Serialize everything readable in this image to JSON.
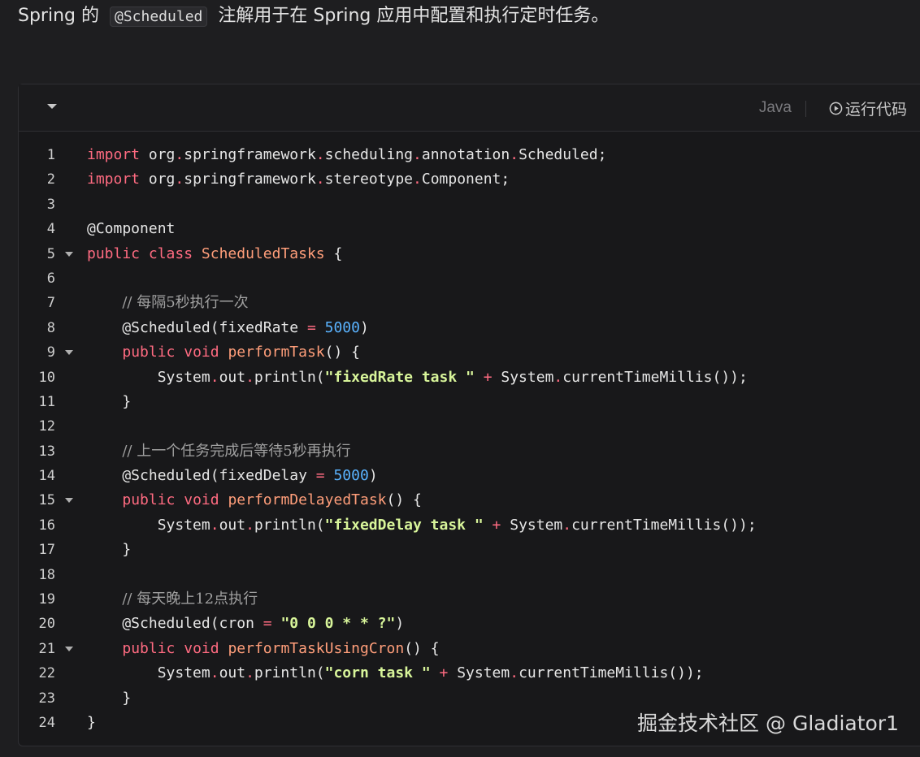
{
  "intro": {
    "before": "Spring 的",
    "code": "@Scheduled",
    "after": "注解用于在 Spring 应用中配置和执行定时任务。"
  },
  "code_block": {
    "language": "Java",
    "run_label": "运行代码",
    "lines": [
      {
        "n": "1",
        "fold": false,
        "tokens": [
          [
            "keyword",
            "import"
          ],
          [
            "plain",
            " org"
          ],
          [
            "punct",
            "."
          ],
          [
            "plain",
            "springframework"
          ],
          [
            "punct",
            "."
          ],
          [
            "plain",
            "scheduling"
          ],
          [
            "punct",
            "."
          ],
          [
            "plain",
            "annotation"
          ],
          [
            "punct",
            "."
          ],
          [
            "plain",
            "Scheduled;"
          ]
        ]
      },
      {
        "n": "2",
        "fold": false,
        "tokens": [
          [
            "keyword",
            "import"
          ],
          [
            "plain",
            " org"
          ],
          [
            "punct",
            "."
          ],
          [
            "plain",
            "springframework"
          ],
          [
            "punct",
            "."
          ],
          [
            "plain",
            "stereotype"
          ],
          [
            "punct",
            "."
          ],
          [
            "plain",
            "Component;"
          ]
        ]
      },
      {
        "n": "3",
        "fold": false,
        "tokens": []
      },
      {
        "n": "4",
        "fold": false,
        "tokens": [
          [
            "plain",
            "@Component"
          ]
        ]
      },
      {
        "n": "5",
        "fold": true,
        "tokens": [
          [
            "keyword",
            "public"
          ],
          [
            "plain",
            " "
          ],
          [
            "keyword",
            "class"
          ],
          [
            "plain",
            " "
          ],
          [
            "class",
            "ScheduledTasks"
          ],
          [
            "plain",
            " {"
          ]
        ]
      },
      {
        "n": "6",
        "fold": false,
        "tokens": []
      },
      {
        "n": "7",
        "fold": false,
        "tokens": [
          [
            "plain",
            "    "
          ],
          [
            "comment",
            "// 每隔5秒执行一次"
          ]
        ]
      },
      {
        "n": "8",
        "fold": false,
        "tokens": [
          [
            "plain",
            "    @Scheduled(fixedRate "
          ],
          [
            "punct",
            "="
          ],
          [
            "plain",
            " "
          ],
          [
            "number",
            "5000"
          ],
          [
            "plain",
            ")"
          ]
        ]
      },
      {
        "n": "9",
        "fold": true,
        "tokens": [
          [
            "plain",
            "    "
          ],
          [
            "keyword",
            "public"
          ],
          [
            "plain",
            " "
          ],
          [
            "keyword",
            "void"
          ],
          [
            "plain",
            " "
          ],
          [
            "method",
            "performTask"
          ],
          [
            "plain",
            "() {"
          ]
        ]
      },
      {
        "n": "10",
        "fold": false,
        "tokens": [
          [
            "plain",
            "        System"
          ],
          [
            "punct",
            "."
          ],
          [
            "plain",
            "out"
          ],
          [
            "punct",
            "."
          ],
          [
            "plain",
            "println("
          ],
          [
            "string",
            "\"fixedRate task \""
          ],
          [
            "plain",
            " "
          ],
          [
            "punct",
            "+"
          ],
          [
            "plain",
            " System"
          ],
          [
            "punct",
            "."
          ],
          [
            "plain",
            "currentTimeMillis());"
          ]
        ]
      },
      {
        "n": "11",
        "fold": false,
        "tokens": [
          [
            "plain",
            "    }"
          ]
        ]
      },
      {
        "n": "12",
        "fold": false,
        "tokens": []
      },
      {
        "n": "13",
        "fold": false,
        "tokens": [
          [
            "plain",
            "    "
          ],
          [
            "comment",
            "// 上一个任务完成后等待5秒再执行"
          ]
        ]
      },
      {
        "n": "14",
        "fold": false,
        "tokens": [
          [
            "plain",
            "    @Scheduled(fixedDelay "
          ],
          [
            "punct",
            "="
          ],
          [
            "plain",
            " "
          ],
          [
            "number",
            "5000"
          ],
          [
            "plain",
            ")"
          ]
        ]
      },
      {
        "n": "15",
        "fold": true,
        "tokens": [
          [
            "plain",
            "    "
          ],
          [
            "keyword",
            "public"
          ],
          [
            "plain",
            " "
          ],
          [
            "keyword",
            "void"
          ],
          [
            "plain",
            " "
          ],
          [
            "method",
            "performDelayedTask"
          ],
          [
            "plain",
            "() {"
          ]
        ]
      },
      {
        "n": "16",
        "fold": false,
        "tokens": [
          [
            "plain",
            "        System"
          ],
          [
            "punct",
            "."
          ],
          [
            "plain",
            "out"
          ],
          [
            "punct",
            "."
          ],
          [
            "plain",
            "println("
          ],
          [
            "string",
            "\"fixedDelay task \""
          ],
          [
            "plain",
            " "
          ],
          [
            "punct",
            "+"
          ],
          [
            "plain",
            " System"
          ],
          [
            "punct",
            "."
          ],
          [
            "plain",
            "currentTimeMillis());"
          ]
        ]
      },
      {
        "n": "17",
        "fold": false,
        "tokens": [
          [
            "plain",
            "    }"
          ]
        ]
      },
      {
        "n": "18",
        "fold": false,
        "tokens": []
      },
      {
        "n": "19",
        "fold": false,
        "tokens": [
          [
            "plain",
            "    "
          ],
          [
            "comment",
            "// 每天晚上12点执行"
          ]
        ]
      },
      {
        "n": "20",
        "fold": false,
        "tokens": [
          [
            "plain",
            "    @Scheduled(cron "
          ],
          [
            "punct",
            "="
          ],
          [
            "plain",
            " "
          ],
          [
            "string",
            "\"0 0 0 * * ?\""
          ],
          [
            "plain",
            ")"
          ]
        ]
      },
      {
        "n": "21",
        "fold": true,
        "tokens": [
          [
            "plain",
            "    "
          ],
          [
            "keyword",
            "public"
          ],
          [
            "plain",
            " "
          ],
          [
            "keyword",
            "void"
          ],
          [
            "plain",
            " "
          ],
          [
            "method",
            "performTaskUsingCron"
          ],
          [
            "plain",
            "() {"
          ]
        ]
      },
      {
        "n": "22",
        "fold": false,
        "tokens": [
          [
            "plain",
            "        System"
          ],
          [
            "punct",
            "."
          ],
          [
            "plain",
            "out"
          ],
          [
            "punct",
            "."
          ],
          [
            "plain",
            "println("
          ],
          [
            "string",
            "\"corn task \""
          ],
          [
            "plain",
            " "
          ],
          [
            "punct",
            "+"
          ],
          [
            "plain",
            " System"
          ],
          [
            "punct",
            "."
          ],
          [
            "plain",
            "currentTimeMillis());"
          ]
        ]
      },
      {
        "n": "23",
        "fold": false,
        "tokens": [
          [
            "plain",
            "    }"
          ]
        ]
      },
      {
        "n": "24",
        "fold": false,
        "tokens": [
          [
            "plain",
            "}"
          ]
        ]
      }
    ]
  },
  "watermark": "掘金技术社区 @ Gladiator1",
  "colors": {
    "background": "#1e1e20",
    "code_background": "#18181a",
    "keyword": "#ff6b81",
    "class_name": "#ff9e7a",
    "number": "#5ab3ff",
    "string": "#d8f59a",
    "comment": "#a0a0a0"
  },
  "icons": {
    "collapse": "chevron-down-icon",
    "run": "play-circle-icon",
    "fold": "fold-arrow-icon"
  }
}
